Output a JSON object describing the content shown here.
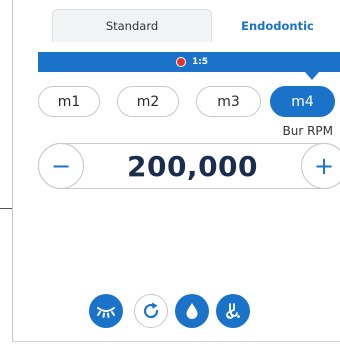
{
  "tabs": [
    {
      "label": "Standard",
      "active": true
    },
    {
      "label": "Endodontic",
      "active": false
    }
  ],
  "ratio": {
    "label": "1:5",
    "indicator_color": "#e0332b"
  },
  "modes": [
    {
      "label": "m1",
      "active": false
    },
    {
      "label": "m2",
      "active": false
    },
    {
      "label": "m3",
      "active": false
    },
    {
      "label": "m4",
      "active": true
    }
  ],
  "speed": {
    "label": "Bur RPM",
    "value": "200,000",
    "decrement_symbol": "−",
    "increment_symbol": "+"
  },
  "tools": [
    {
      "icon": "light-off-icon",
      "style": "filled"
    },
    {
      "icon": "reverse-rotation-icon",
      "style": "outline"
    },
    {
      "icon": "water-drop-icon",
      "style": "filled"
    },
    {
      "icon": "spray-air-icon",
      "style": "filled"
    }
  ],
  "colors": {
    "accent": "#1a73c9",
    "text_dark": "#1b2d4f",
    "border": "#c4c9d0"
  }
}
